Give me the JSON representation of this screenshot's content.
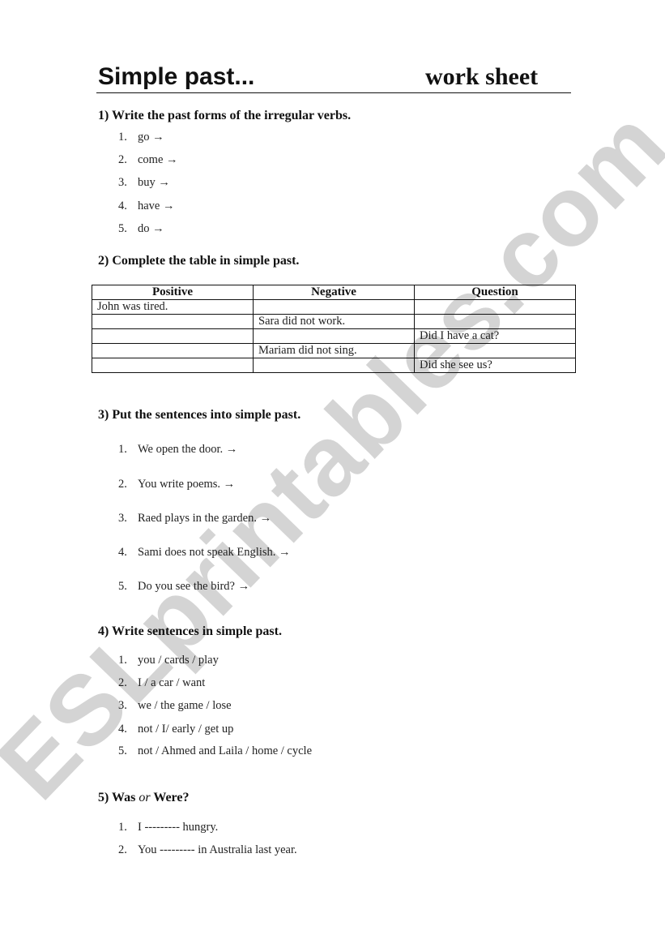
{
  "watermark": "ESLprintables.com",
  "title": {
    "left": "Simple past...",
    "right": "work sheet"
  },
  "section1": {
    "heading": "1) Write the past forms of the irregular verbs.",
    "items": [
      {
        "num": "1.",
        "text": "go →"
      },
      {
        "num": "2.",
        "text": "come →"
      },
      {
        "num": "3.",
        "text": "buy →"
      },
      {
        "num": "4.",
        "text": "have →"
      },
      {
        "num": "5.",
        "text": "do →"
      }
    ]
  },
  "section2": {
    "heading": "2) Complete the table in simple past.",
    "columns": [
      "Positive",
      "Negative",
      "Question"
    ],
    "rows": [
      [
        "John was tired.",
        "",
        ""
      ],
      [
        "",
        "Sara did not work.",
        ""
      ],
      [
        "",
        "",
        "Did I have a cat?"
      ],
      [
        "",
        "Mariam did not sing.",
        ""
      ],
      [
        "",
        "",
        "Did she see us?"
      ]
    ]
  },
  "section3": {
    "heading": "3) Put the sentences into simple past.",
    "items": [
      {
        "num": "1.",
        "text": "We open the door. →"
      },
      {
        "num": "2.",
        "text": "You write poems. →"
      },
      {
        "num": "3.",
        "text": "Raed plays in the garden. →"
      },
      {
        "num": "4.",
        "text": "Sami does not speak English. →"
      },
      {
        "num": "5.",
        "text": "Do you see the bird? →"
      }
    ]
  },
  "section4": {
    "heading": "4) Write sentences in simple past.",
    "items": [
      {
        "num": "1.",
        "text": "you / cards / play"
      },
      {
        "num": "2.",
        "text": "I / a car / want"
      },
      {
        "num": "3.",
        "text": "we / the game / lose"
      },
      {
        "num": "4.",
        "text": "not / I/ early / get up"
      },
      {
        "num": "5.",
        "text": "not / Ahmed and Laila / home / cycle"
      }
    ]
  },
  "section5": {
    "heading_a": "5) Was ",
    "heading_or": "or",
    "heading_b": " Were?",
    "items": [
      {
        "num": "1.",
        "text": "I --------- hungry."
      },
      {
        "num": "2.",
        "text": "You --------- in Australia last year."
      }
    ]
  }
}
